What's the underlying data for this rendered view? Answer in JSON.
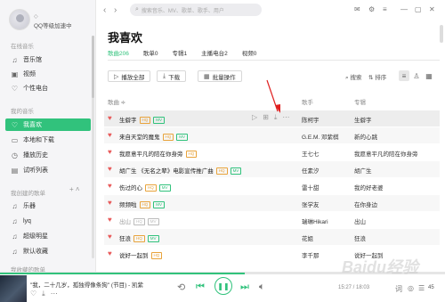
{
  "user": {
    "level": "◇",
    "name": "QQ等级加速中"
  },
  "sidebar": {
    "online_title": "在线音乐",
    "online": [
      {
        "icon": "music-hall-icon",
        "glyph": "♫",
        "label": "音乐馆"
      },
      {
        "icon": "video-icon",
        "glyph": "▣",
        "label": "视频"
      },
      {
        "icon": "radio-icon",
        "glyph": "♡",
        "label": "个性电台"
      }
    ],
    "my_title": "我的音乐",
    "my": [
      {
        "icon": "heart-icon",
        "glyph": "♡",
        "label": "我喜欢",
        "active": true
      },
      {
        "icon": "local-icon",
        "glyph": "▭",
        "label": "本地和下载"
      },
      {
        "icon": "history-icon",
        "glyph": "◷",
        "label": "播放历史"
      },
      {
        "icon": "trial-icon",
        "glyph": "▤",
        "label": "试听列表"
      }
    ],
    "created_title": "我创建的歌单",
    "created_actions": "+  ˄",
    "created": [
      {
        "icon": "playlist-icon",
        "glyph": "♫",
        "label": "乐器"
      },
      {
        "icon": "playlist-icon",
        "glyph": "♫",
        "label": "lyq"
      },
      {
        "icon": "playlist-icon",
        "glyph": "♫",
        "label": "超级明星"
      },
      {
        "icon": "playlist-icon",
        "glyph": "♫",
        "label": "默认收藏"
      }
    ],
    "collected_title": "我收藏的歌单"
  },
  "topbar": {
    "back": "‹",
    "forward": "›",
    "search_placeholder": "搜索音乐、MV、歌单、歌手、用户",
    "controls": [
      "✉",
      "⚙",
      "≡",
      "—",
      "▢",
      "✕"
    ]
  },
  "page": {
    "title": "我喜欢",
    "tabs": [
      {
        "label": "歌曲206",
        "active": true
      },
      {
        "label": "歌单0"
      },
      {
        "label": "专辑1"
      },
      {
        "label": "主播电台2"
      },
      {
        "label": "视频0"
      }
    ],
    "play_all": "播放全部",
    "download": "下载",
    "batch": "批量操作",
    "search": "搜索",
    "sort": "排序",
    "columns": {
      "song": "歌曲 ≑",
      "artist": "歌手",
      "album": "专辑"
    }
  },
  "songs": [
    {
      "title": "生僻字",
      "badges": [
        "HQ",
        "MV"
      ],
      "artist": "陈柯宇",
      "album": "生僻字",
      "hover": true
    },
    {
      "title": "来自天堂的魔鬼",
      "badges": [
        "HQ",
        "MV"
      ],
      "artist": "G.E.M. 邓紫棋",
      "album": "新的心跳"
    },
    {
      "title": "我愿意平凡的陪在你身旁",
      "badges": [
        "HQ"
      ],
      "artist": "王七七",
      "album": "我愿意平凡的陪在你身旁"
    },
    {
      "title": "胡广生 《无名之辈》电影宣传推广曲",
      "badges": [
        "HQ",
        "MV"
      ],
      "artist": "任素汐",
      "album": "胡广生"
    },
    {
      "title": "伤过的心",
      "badges": [
        "HQ",
        "MV"
      ],
      "artist": "雷十甜",
      "album": "我的好老婆"
    },
    {
      "title": "频频啦",
      "badges": [
        "HQ",
        "MV"
      ],
      "artist": "张学友",
      "album": "在你身边"
    },
    {
      "title": "出山",
      "badges": [
        "HQ",
        "MV"
      ],
      "artist": "瑞琳Hikari",
      "album": "出山",
      "gray": true
    },
    {
      "title": "狂浪",
      "badges": [
        "HQ",
        "MV"
      ],
      "artist": "花姐",
      "album": "狂浪"
    },
    {
      "title": "说好一起到",
      "badges": [
        "HQ"
      ],
      "artist": "李千那",
      "album": "说好一起到"
    }
  ],
  "player": {
    "now_playing": "\"我，二十几岁，孤独得像条狗\" (节目) - 凯紫",
    "progress": 0.55,
    "time": "15:27 / 18:03",
    "count": "45"
  },
  "watermark": "Baidu经验",
  "colors": {
    "accent": "#31c27c",
    "heart": "#e85a5a",
    "annotation": "#e02020"
  }
}
